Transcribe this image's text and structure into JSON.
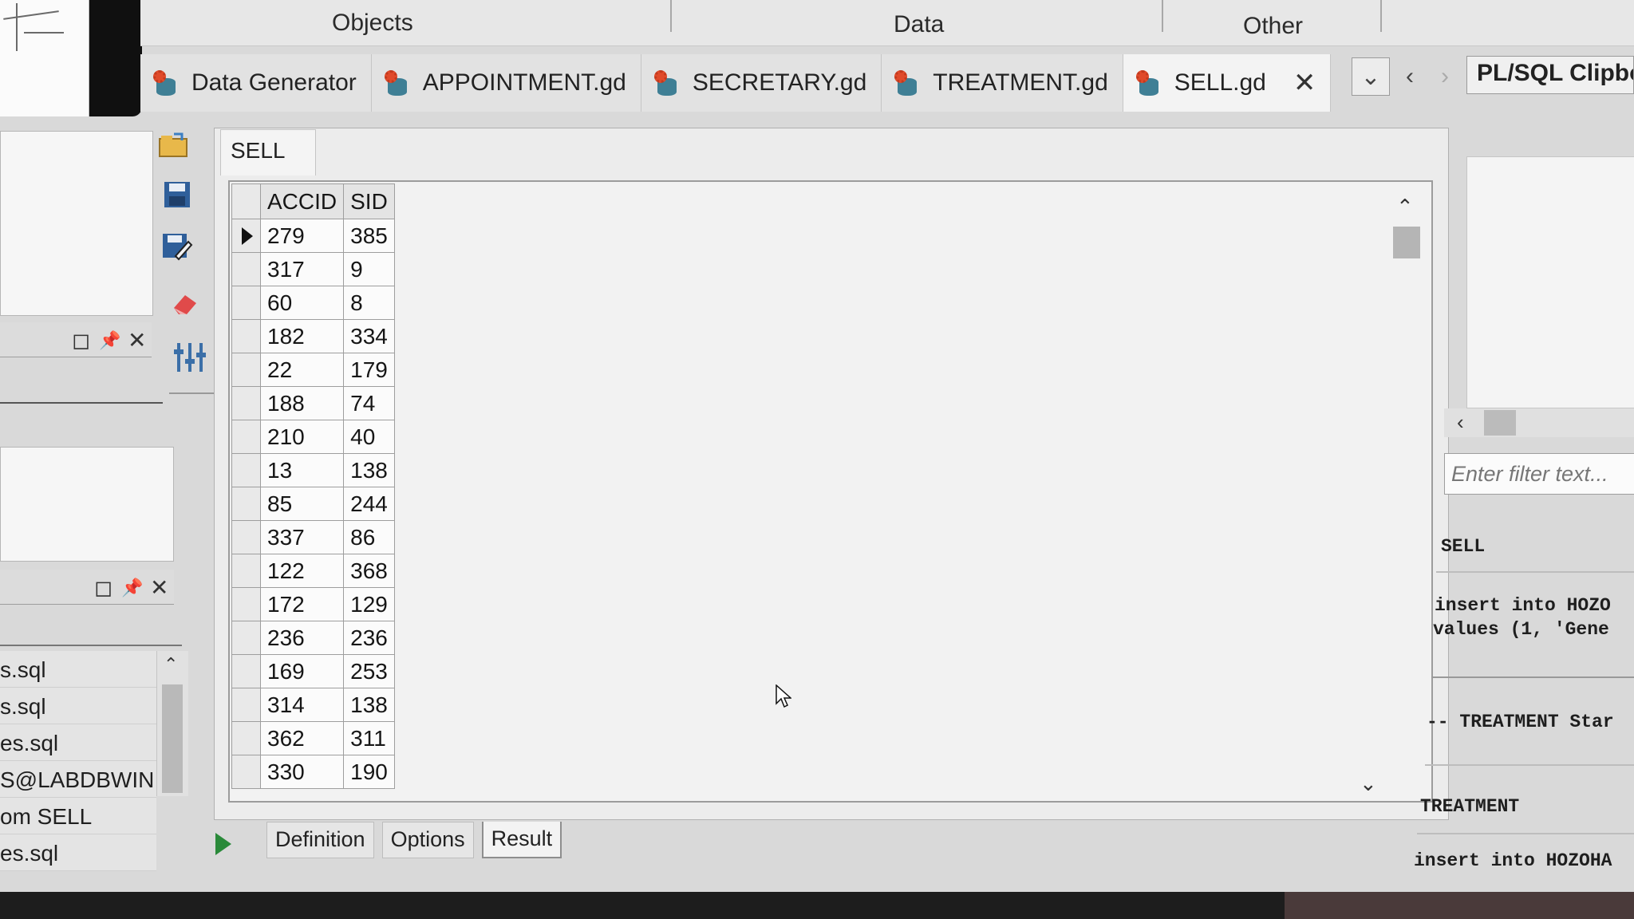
{
  "categories": [
    "Objects",
    "Data",
    "Other"
  ],
  "tabs": [
    {
      "label": "Data Generator",
      "active": false
    },
    {
      "label": "APPOINTMENT.gd",
      "active": false
    },
    {
      "label": "SECRETARY.gd",
      "active": false
    },
    {
      "label": "TREATMENT.gd",
      "active": false
    },
    {
      "label": "SELL.gd",
      "active": true
    }
  ],
  "tab_close": "✕",
  "tab_controls": {
    "dropdown": "⌄",
    "prev": "‹",
    "next": "›"
  },
  "clipboard_tab": "PL/SQL Clipboa",
  "left_files": [
    "s.sql",
    "s.sql",
    "es.sql",
    "S@LABDBWIN",
    "om SELL",
    "es.sql"
  ],
  "panel_controls": [
    "◻",
    "📌",
    "✕"
  ],
  "editor": {
    "sub_tab": "SELL",
    "columns": [
      "ACCID",
      "SID"
    ],
    "rows": [
      [
        "279",
        "385"
      ],
      [
        "317",
        "9"
      ],
      [
        "60",
        "8"
      ],
      [
        "182",
        "334"
      ],
      [
        "22",
        "179"
      ],
      [
        "188",
        "74"
      ],
      [
        "210",
        "40"
      ],
      [
        "13",
        "138"
      ],
      [
        "85",
        "244"
      ],
      [
        "337",
        "86"
      ],
      [
        "122",
        "368"
      ],
      [
        "172",
        "129"
      ],
      [
        "236",
        "236"
      ],
      [
        "169",
        "253"
      ],
      [
        "314",
        "138"
      ],
      [
        "362",
        "311"
      ],
      [
        "330",
        "190"
      ]
    ]
  },
  "bottom_tabs": [
    {
      "label": "Definition",
      "active": false
    },
    {
      "label": "Options",
      "active": false
    },
    {
      "label": "Result",
      "active": true
    }
  ],
  "right_panel": {
    "filter_placeholder": "Enter filter text...",
    "code_lines": [
      "SELL",
      "insert into HOZO",
      "values (1, 'Gene",
      "-- TREATMENT Star",
      "TREATMENT",
      "insert into HOZOHA"
    ]
  }
}
